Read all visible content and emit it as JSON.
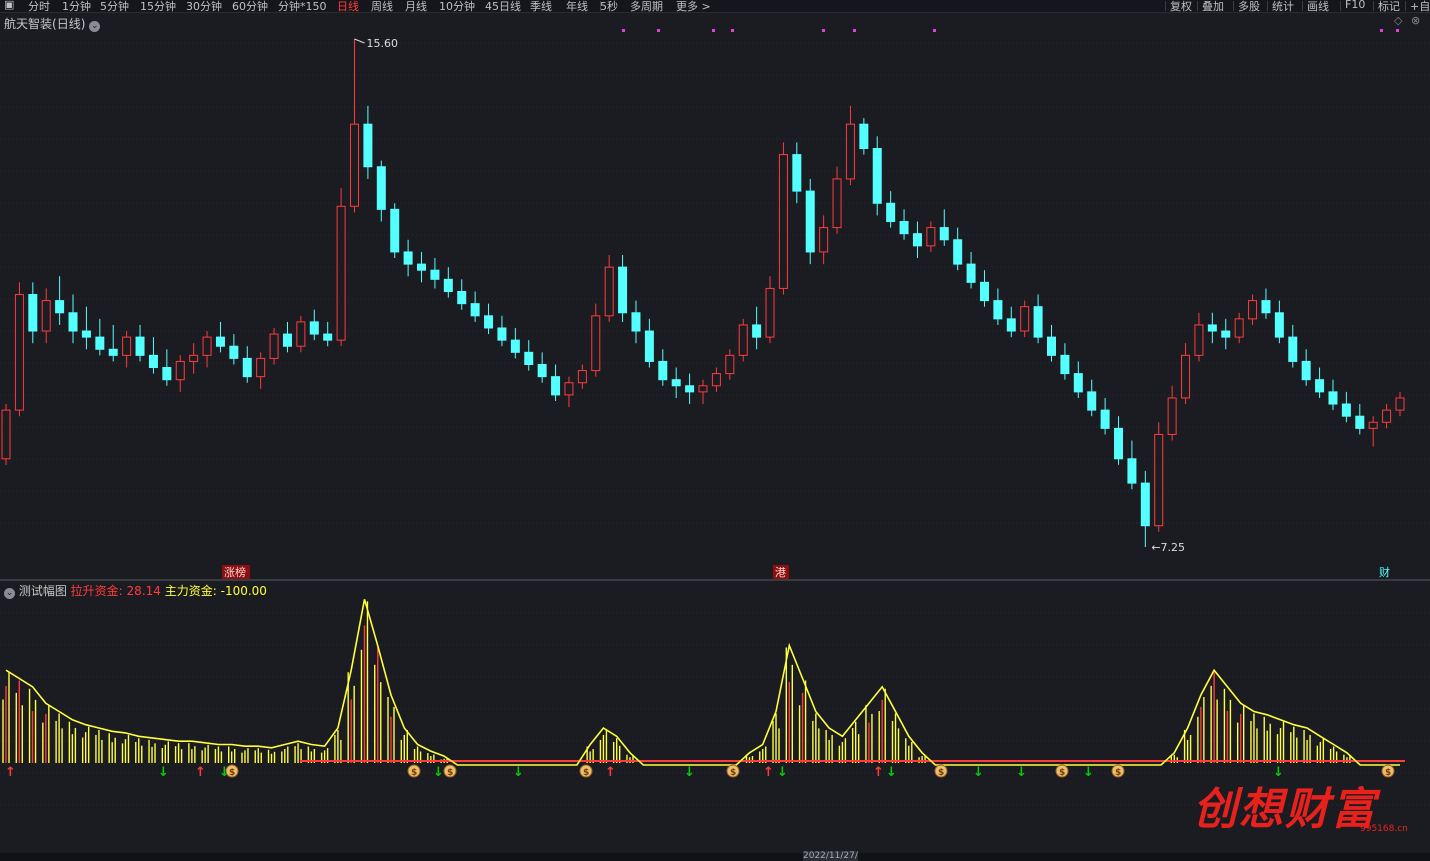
{
  "toolbar": {
    "periods": [
      "分时",
      "1分钟",
      "5分钟",
      "15分钟",
      "30分钟",
      "60分钟",
      "分钟*150",
      "日线",
      "周线",
      "月线",
      "10分钟",
      "45日线",
      "季线",
      "年线",
      "5秒",
      "多周期",
      "更多 >"
    ],
    "active": "日线",
    "right": [
      "复权",
      "叠加",
      "多股",
      "统计",
      "画线",
      "F10",
      "标记",
      "+自"
    ]
  },
  "main": {
    "stock_name": "航天智装",
    "period": "(日线)",
    "high_label": "15.60",
    "low_label": "7.25",
    "markers": {
      "limit_up": "涨榜",
      "hk": "港",
      "finance": "财"
    }
  },
  "sub": {
    "indicator": "测试幅图",
    "series1_label": "拉升资金:",
    "series1_value": "28.14",
    "series2_label": "主力资金:",
    "series2_value": "-100.00"
  },
  "axis": {
    "date_fragment": "2022/11/27/"
  },
  "watermark": {
    "text": "创想财富",
    "site": "995168.cn"
  },
  "colors": {
    "up": "#ff3b3b",
    "down": "#54ffff",
    "yellow": "#ffff3b",
    "bg": "#1b1c22",
    "green": "#00d000"
  },
  "chart_data": {
    "type": "candlestick",
    "title": "航天智装(日线)",
    "price_range": [
      7.25,
      15.6
    ],
    "candles_ohlc": [
      [
        8.7,
        9.6,
        8.6,
        9.5
      ],
      [
        9.5,
        11.6,
        9.4,
        11.4
      ],
      [
        11.4,
        11.6,
        10.6,
        10.8
      ],
      [
        10.8,
        11.5,
        10.6,
        11.3
      ],
      [
        11.3,
        11.7,
        10.9,
        11.1
      ],
      [
        11.1,
        11.4,
        10.6,
        10.8
      ],
      [
        10.8,
        11.2,
        10.5,
        10.7
      ],
      [
        10.7,
        11.0,
        10.4,
        10.5
      ],
      [
        10.5,
        10.9,
        10.3,
        10.4
      ],
      [
        10.4,
        10.8,
        10.2,
        10.7
      ],
      [
        10.7,
        10.9,
        10.3,
        10.4
      ],
      [
        10.4,
        10.7,
        10.1,
        10.2
      ],
      [
        10.2,
        10.5,
        9.9,
        10.0
      ],
      [
        10.0,
        10.4,
        9.8,
        10.3
      ],
      [
        10.3,
        10.6,
        10.1,
        10.4
      ],
      [
        10.4,
        10.8,
        10.2,
        10.7
      ],
      [
        10.7,
        10.95,
        10.45,
        10.55
      ],
      [
        10.55,
        10.75,
        10.25,
        10.35
      ],
      [
        10.35,
        10.55,
        9.95,
        10.05
      ],
      [
        10.05,
        10.45,
        9.85,
        10.35
      ],
      [
        10.35,
        10.85,
        10.25,
        10.75
      ],
      [
        10.75,
        10.95,
        10.45,
        10.55
      ],
      [
        10.55,
        11.05,
        10.45,
        10.95
      ],
      [
        10.95,
        11.15,
        10.65,
        10.75
      ],
      [
        10.75,
        10.95,
        10.55,
        10.65
      ],
      [
        10.65,
        13.15,
        10.55,
        12.85
      ],
      [
        12.85,
        15.6,
        12.75,
        14.2
      ],
      [
        14.2,
        14.5,
        13.3,
        13.5
      ],
      [
        13.5,
        13.6,
        12.6,
        12.8
      ],
      [
        12.8,
        12.9,
        12.0,
        12.1
      ],
      [
        12.1,
        12.3,
        11.7,
        11.9
      ],
      [
        11.9,
        12.1,
        11.6,
        11.8
      ],
      [
        11.8,
        12.0,
        11.5,
        11.65
      ],
      [
        11.65,
        11.85,
        11.35,
        11.45
      ],
      [
        11.45,
        11.65,
        11.15,
        11.25
      ],
      [
        11.25,
        11.45,
        10.95,
        11.05
      ],
      [
        11.05,
        11.25,
        10.75,
        10.85
      ],
      [
        10.85,
        11.05,
        10.55,
        10.65
      ],
      [
        10.65,
        10.85,
        10.35,
        10.45
      ],
      [
        10.45,
        10.65,
        10.15,
        10.25
      ],
      [
        10.25,
        10.45,
        9.95,
        10.05
      ],
      [
        10.05,
        10.25,
        9.65,
        9.75
      ],
      [
        9.75,
        10.05,
        9.55,
        9.95
      ],
      [
        9.95,
        10.25,
        9.85,
        10.15
      ],
      [
        10.15,
        11.25,
        10.05,
        11.05
      ],
      [
        11.05,
        12.05,
        10.95,
        11.85
      ],
      [
        11.85,
        12.05,
        10.95,
        11.1
      ],
      [
        11.1,
        11.3,
        10.6,
        10.8
      ],
      [
        10.8,
        11.0,
        10.2,
        10.3
      ],
      [
        10.3,
        10.5,
        9.9,
        10.0
      ],
      [
        10.0,
        10.2,
        9.7,
        9.9
      ],
      [
        9.9,
        10.1,
        9.6,
        9.8
      ],
      [
        9.8,
        10.0,
        9.6,
        9.9
      ],
      [
        9.9,
        10.2,
        9.8,
        10.1
      ],
      [
        10.1,
        10.5,
        10.0,
        10.4
      ],
      [
        10.4,
        11.0,
        10.3,
        10.9
      ],
      [
        10.9,
        11.2,
        10.5,
        10.7
      ],
      [
        10.7,
        11.7,
        10.6,
        11.5
      ],
      [
        11.5,
        13.9,
        11.4,
        13.7
      ],
      [
        13.7,
        13.9,
        12.9,
        13.1
      ],
      [
        13.1,
        13.3,
        11.9,
        12.1
      ],
      [
        12.1,
        12.7,
        11.9,
        12.5
      ],
      [
        12.5,
        13.5,
        12.4,
        13.3
      ],
      [
        13.3,
        14.5,
        13.2,
        14.2
      ],
      [
        14.2,
        14.3,
        13.7,
        13.8
      ],
      [
        13.8,
        14.0,
        12.7,
        12.9
      ],
      [
        12.9,
        13.1,
        12.5,
        12.6
      ],
      [
        12.6,
        12.8,
        12.3,
        12.4
      ],
      [
        12.4,
        12.6,
        12.0,
        12.2
      ],
      [
        12.2,
        12.6,
        12.1,
        12.5
      ],
      [
        12.5,
        12.8,
        12.2,
        12.3
      ],
      [
        12.3,
        12.5,
        11.8,
        11.9
      ],
      [
        11.9,
        12.1,
        11.5,
        11.6
      ],
      [
        11.6,
        11.8,
        11.2,
        11.3
      ],
      [
        11.3,
        11.5,
        10.9,
        11.0
      ],
      [
        11.0,
        11.2,
        10.7,
        10.8
      ],
      [
        10.8,
        11.3,
        10.7,
        11.2
      ],
      [
        11.2,
        11.4,
        10.6,
        10.7
      ],
      [
        10.7,
        10.9,
        10.3,
        10.4
      ],
      [
        10.4,
        10.6,
        10.0,
        10.1
      ],
      [
        10.1,
        10.3,
        9.7,
        9.8
      ],
      [
        9.8,
        10.0,
        9.4,
        9.5
      ],
      [
        9.5,
        9.7,
        9.1,
        9.2
      ],
      [
        9.2,
        9.4,
        8.6,
        8.7
      ],
      [
        8.7,
        9.0,
        8.2,
        8.3
      ],
      [
        8.3,
        8.5,
        7.25,
        7.6
      ],
      [
        7.6,
        9.3,
        7.5,
        9.1
      ],
      [
        9.1,
        9.9,
        9.0,
        9.7
      ],
      [
        9.7,
        10.6,
        9.6,
        10.4
      ],
      [
        10.4,
        11.1,
        10.3,
        10.9
      ],
      [
        10.9,
        11.1,
        10.6,
        10.8
      ],
      [
        10.8,
        11.0,
        10.5,
        10.7
      ],
      [
        10.7,
        11.1,
        10.6,
        11.0
      ],
      [
        11.0,
        11.4,
        10.9,
        11.3
      ],
      [
        11.3,
        11.5,
        11.0,
        11.1
      ],
      [
        11.1,
        11.3,
        10.6,
        10.7
      ],
      [
        10.7,
        10.9,
        10.2,
        10.3
      ],
      [
        10.3,
        10.5,
        9.9,
        10.0
      ],
      [
        10.0,
        10.2,
        9.7,
        9.8
      ],
      [
        9.8,
        10.0,
        9.5,
        9.6
      ],
      [
        9.6,
        9.8,
        9.3,
        9.4
      ],
      [
        9.4,
        9.6,
        9.1,
        9.2
      ],
      [
        9.2,
        9.4,
        8.9,
        9.3
      ],
      [
        9.3,
        9.6,
        9.2,
        9.5
      ],
      [
        9.5,
        9.8,
        9.4,
        9.7
      ]
    ],
    "indicator_bars": [
      0.55,
      0.5,
      0.45,
      0.35,
      0.3,
      0.25,
      0.22,
      0.2,
      0.18,
      0.17,
      0.15,
      0.14,
      0.13,
      0.12,
      0.12,
      0.11,
      0.1,
      0.1,
      0.09,
      0.09,
      0.08,
      0.1,
      0.12,
      0.1,
      0.09,
      0.2,
      0.55,
      0.98,
      0.7,
      0.4,
      0.2,
      0.1,
      0.06,
      0.03,
      0,
      0,
      0,
      0,
      0,
      0,
      0,
      0,
      0,
      0,
      0.1,
      0.2,
      0.15,
      0.05,
      0,
      0,
      0,
      0,
      0,
      0,
      0,
      0,
      0.05,
      0.1,
      0.3,
      0.7,
      0.5,
      0.3,
      0.2,
      0.15,
      0.25,
      0.35,
      0.45,
      0.3,
      0.15,
      0.05,
      0,
      0,
      0,
      0,
      0,
      0,
      0,
      0,
      0,
      0,
      0,
      0,
      0,
      0,
      0,
      0,
      0,
      0,
      0.05,
      0.2,
      0.4,
      0.55,
      0.45,
      0.35,
      0.3,
      0.28,
      0.25,
      0.22,
      0.2,
      0.15,
      0.1,
      0.05,
      0,
      0,
      0,
      0
    ]
  }
}
